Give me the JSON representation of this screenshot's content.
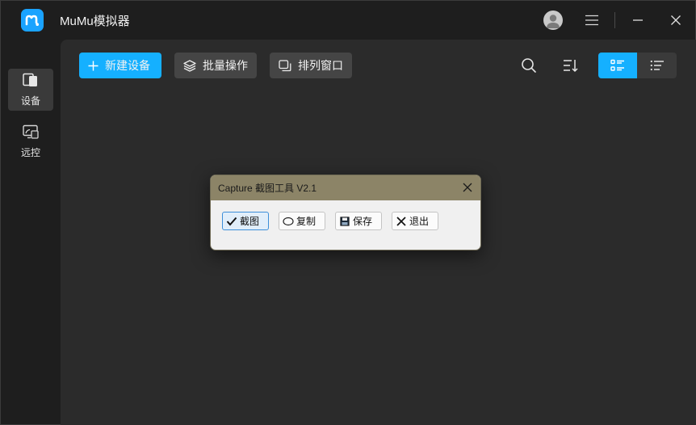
{
  "app": {
    "title": "MuMu模拟器"
  },
  "colors": {
    "accent": "#15b0ff",
    "logo": "#1aa3ff",
    "dialog_title_bg": "#8c8467"
  },
  "titlebar": {
    "avatar_icon": "user-avatar-icon",
    "menu_icon": "hamburger-menu-icon",
    "minimize_icon": "minimize-icon",
    "close_icon": "close-icon"
  },
  "sidebar": {
    "items": [
      {
        "label": "设备",
        "icon": "device-icon",
        "active": true
      },
      {
        "label": "远控",
        "icon": "remote-control-icon",
        "active": false
      }
    ]
  },
  "toolbar": {
    "new_device": "新建设备",
    "batch_ops": "批量操作",
    "arrange_windows": "排列窗口",
    "search_icon": "search-icon",
    "sort_icon": "sort-icon",
    "view_modes": [
      {
        "icon": "card-view-icon",
        "active": true
      },
      {
        "icon": "list-view-icon",
        "active": false
      }
    ]
  },
  "dialog": {
    "title": "Capture 截图工具 V2.1",
    "buttons": [
      {
        "label": "截图",
        "icon": "checkmark-icon",
        "selected": true
      },
      {
        "label": "复制",
        "icon": "ellipse-icon",
        "selected": false
      },
      {
        "label": "保存",
        "icon": "floppy-disk-icon",
        "selected": false
      },
      {
        "label": "退出",
        "icon": "x-cross-icon",
        "selected": false
      }
    ]
  }
}
